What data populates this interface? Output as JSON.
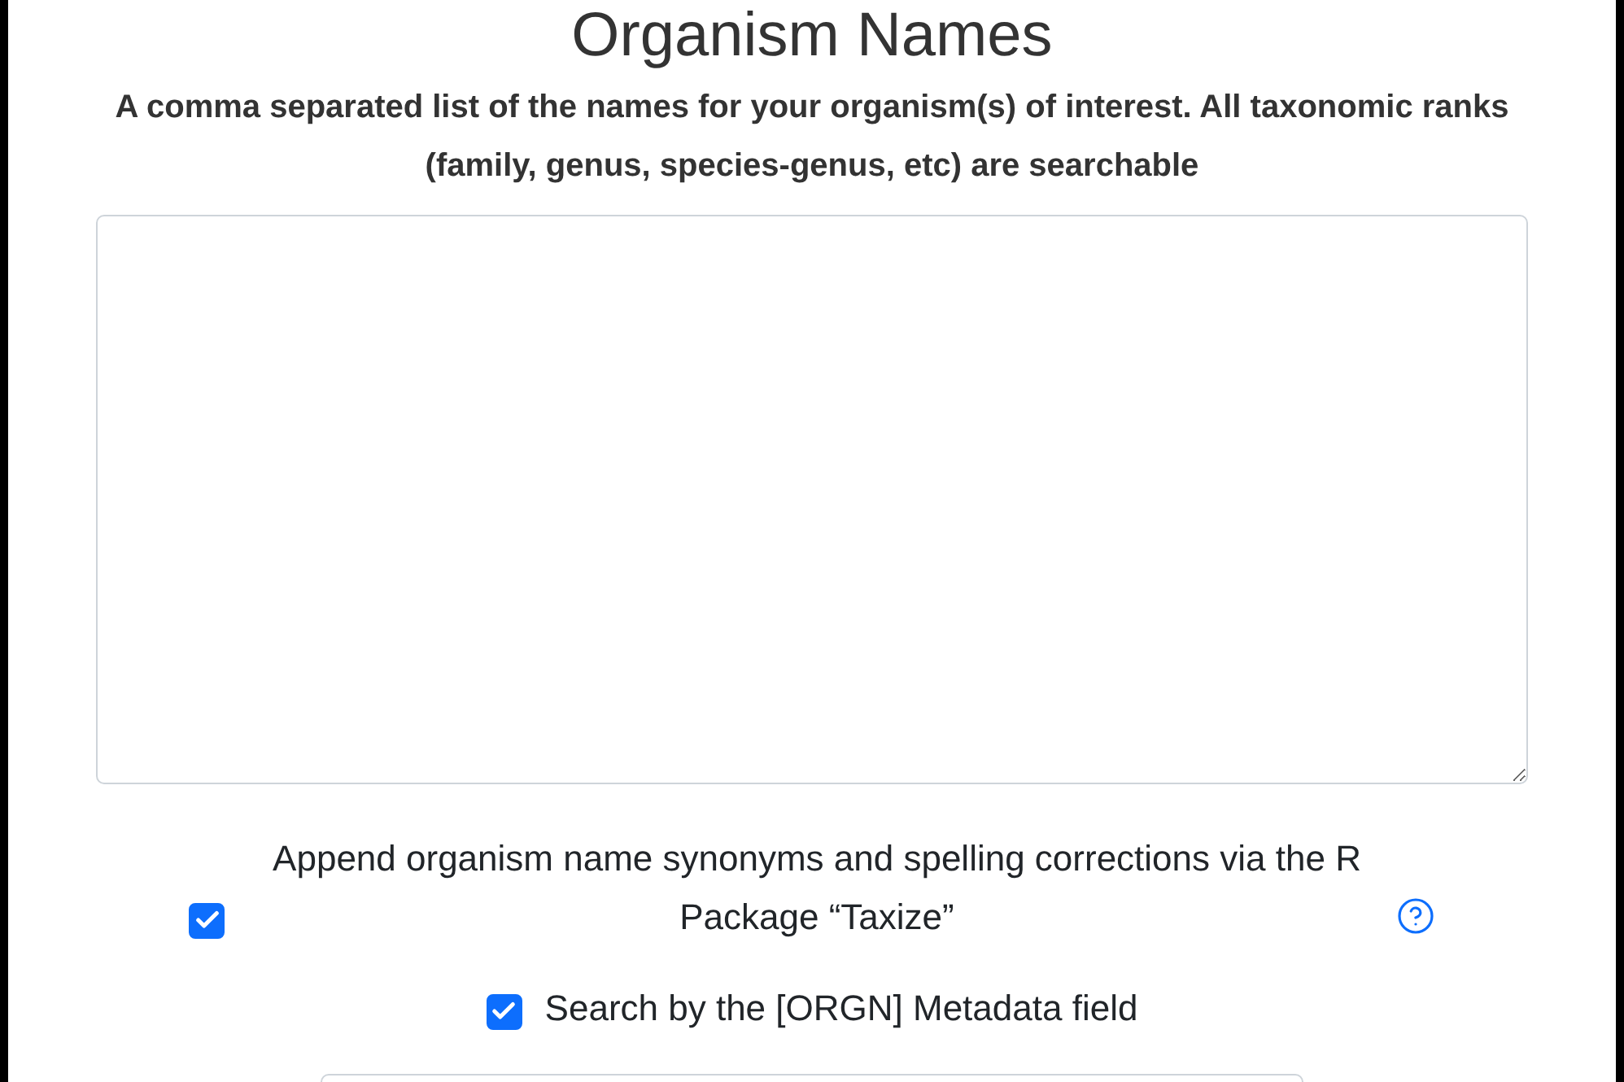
{
  "heading": "Organism Names",
  "description": "A comma separated list of the names for your organism(s) of interest. All taxonomic ranks (family, genus, species-genus, etc) are searchable",
  "options": [
    {
      "label": "Append organism name synonyms and spelling corrections via the R Package “Taxize”",
      "checked": true,
      "help": true
    },
    {
      "label": "Search by the [ORGN] Metadata field",
      "checked": true,
      "help": false
    }
  ]
}
